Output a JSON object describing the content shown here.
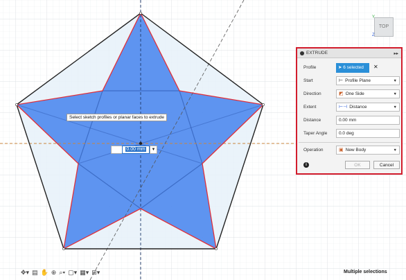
{
  "viewport": {
    "tooltip": "Select sketch profiles or planar faces to extrude",
    "dimension_value": "0.00 mm",
    "viewcube": {
      "face": "TOP",
      "axis_y": "Y",
      "axis_z": "Z"
    }
  },
  "panel": {
    "title": "EXTRUDE",
    "profile": {
      "label": "Profile",
      "selection": "6 selected",
      "clear": "✕"
    },
    "start": {
      "label": "Start",
      "value": "Profile Plane"
    },
    "direction": {
      "label": "Direction",
      "value": "One Side"
    },
    "extent": {
      "label": "Extent",
      "value": "Distance"
    },
    "distance": {
      "label": "Distance",
      "value": "0.00 mm"
    },
    "taper": {
      "label": "Taper Angle",
      "value": "0.0 deg"
    },
    "operation": {
      "label": "Operation",
      "value": "New Body"
    },
    "info_icon": "i",
    "ok": "OK",
    "cancel": "Cancel"
  },
  "status_text": "Multiple selections",
  "colors": {
    "highlight_border": "#d21c2c",
    "selection_blue": "#2a8fd8",
    "profile_fill": "#4a86ee"
  }
}
